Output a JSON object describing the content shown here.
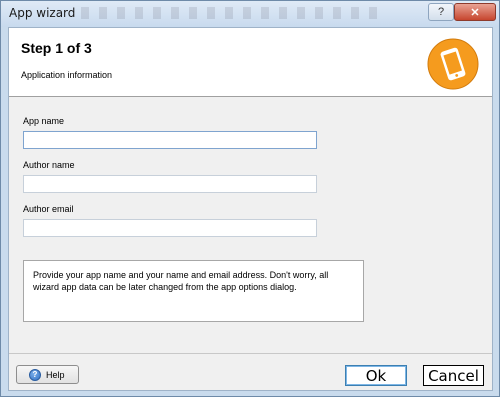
{
  "window": {
    "title": "App wizard",
    "help_glyph": "?",
    "close_glyph": "✕"
  },
  "header": {
    "step_title": "Step 1 of 3",
    "subtitle": "Application information",
    "logo_icon": "phone-icon",
    "logo_color": "#f59b1e"
  },
  "form": {
    "app_name": {
      "label": "App name",
      "value": ""
    },
    "author_name": {
      "label": "Author name",
      "value": ""
    },
    "author_email": {
      "label": "Author email",
      "value": ""
    }
  },
  "info_text": "Provide your app name and your name and email address. Don't worry, all wizard app data can be later changed from the app options dialog.",
  "footer": {
    "help_label": "Help",
    "help_icon_glyph": "?",
    "ok_label": "Ok",
    "cancel_label": "Cancel"
  }
}
